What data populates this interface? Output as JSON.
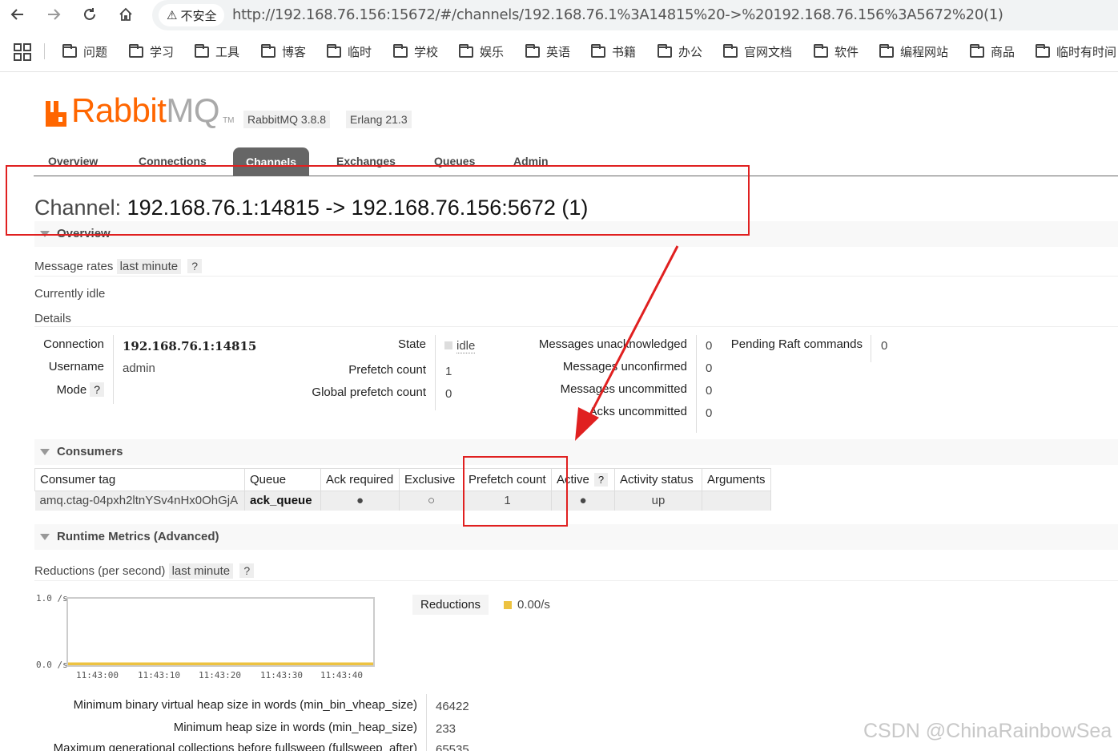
{
  "browser": {
    "security_label": "不安全",
    "url": "http://192.168.76.156:15672/#/channels/192.168.76.1%3A14815%20->%20192.168.76.156%3A5672%20(1)",
    "bookmarks": [
      "问题",
      "学习",
      "工具",
      "博客",
      "临时",
      "学校",
      "娱乐",
      "英语",
      "书籍",
      "办公",
      "官网文档",
      "软件",
      "编程网站",
      "商品",
      "临时有时间"
    ]
  },
  "header": {
    "logo_rabbit": "Rabbit",
    "logo_mq": "MQ",
    "logo_tm": "TM",
    "version": "RabbitMQ 3.8.8",
    "erlang": "Erlang 21.3",
    "tabs": [
      "Overview",
      "Connections",
      "Channels",
      "Exchanges",
      "Queues",
      "Admin"
    ],
    "active_tab": "Channels"
  },
  "page": {
    "title_prefix": "Channel:",
    "title_value": "192.168.76.1:14815 -> 192.168.76.156:5672 (1)"
  },
  "overview": {
    "heading": "Overview",
    "message_rates_label": "Message rates",
    "message_rates_period": "last minute",
    "help": "?",
    "idle_text": "Currently idle",
    "details_label": "Details",
    "connection_k": "Connection",
    "connection_v": "192.168.76.1:14815",
    "username_k": "Username",
    "username_v": "admin",
    "mode_k": "Mode",
    "state_k": "State",
    "state_v": "idle",
    "prefetch_k": "Prefetch count",
    "prefetch_v": "1",
    "global_prefetch_k": "Global prefetch count",
    "global_prefetch_v": "0",
    "unacked_k": "Messages unacknowledged",
    "unacked_v": "0",
    "unconfirmed_k": "Messages unconfirmed",
    "unconfirmed_v": "0",
    "uncommitted_k": "Messages uncommitted",
    "uncommitted_v": "0",
    "acks_uncommitted_k": "Acks uncommitted",
    "acks_uncommitted_v": "0",
    "raft_k": "Pending Raft commands",
    "raft_v": "0"
  },
  "consumers": {
    "heading": "Consumers",
    "columns": [
      "Consumer tag",
      "Queue",
      "Ack required",
      "Exclusive",
      "Prefetch count",
      "Active",
      "Activity status",
      "Arguments"
    ],
    "help": "?",
    "row": {
      "tag": "amq.ctag-04pxh2ltnYSv4nHx0OhGjA",
      "queue": "ack_queue",
      "ack_required": "●",
      "exclusive": "○",
      "prefetch": "1",
      "active": "●",
      "status": "up",
      "arguments": ""
    }
  },
  "runtime": {
    "heading": "Runtime Metrics (Advanced)",
    "reductions_label": "Reductions (per second)",
    "period": "last minute",
    "help": "?",
    "legend_label": "Reductions",
    "legend_value": "0.00/s",
    "legend_color": "#edc240",
    "metrics": [
      {
        "k": "Minimum binary virtual heap size in words (min_bin_vheap_size)",
        "v": "46422"
      },
      {
        "k": "Minimum heap size in words (min_heap_size)",
        "v": "233"
      },
      {
        "k": "Maximum generational collections before fullsweep (fullsweep_after)",
        "v": "65535"
      }
    ]
  },
  "chart_data": {
    "type": "line",
    "title": "",
    "xlabel": "",
    "ylabel": "",
    "x": [
      "11:43:00",
      "11:43:10",
      "11:43:20",
      "11:43:30",
      "11:43:40"
    ],
    "series": [
      {
        "name": "Reductions",
        "values": [
          0,
          0,
          0,
          0,
          0
        ]
      }
    ],
    "ylim": [
      0,
      1.0
    ],
    "y_ticks": [
      "1.0 /s",
      "0.0 /s"
    ],
    "grid": false
  },
  "watermark": "CSDN @ChinaRainbowSea"
}
